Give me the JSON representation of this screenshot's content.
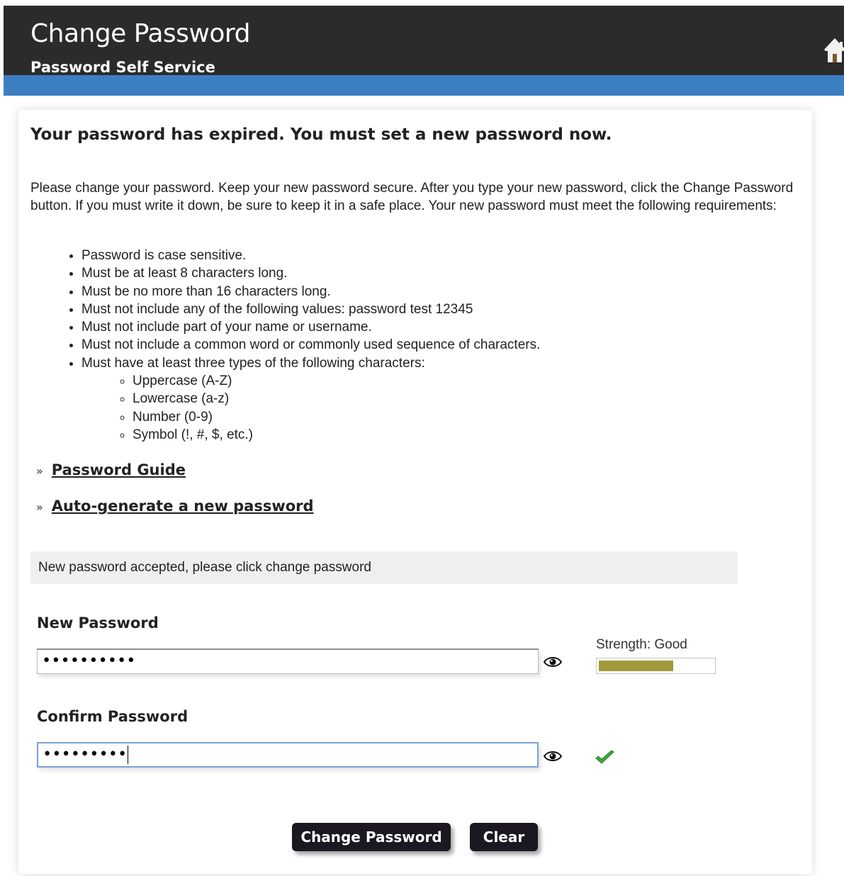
{
  "header": {
    "title": "Change Password",
    "subtitle": "Password Self Service",
    "home_icon": "home-icon"
  },
  "main": {
    "headline": "Your password has expired. You must set a new password now.",
    "intro": "Please change your password. Keep your new password secure. After you type your new password, click the Change Password button. If you must write it down, be sure to keep it in a safe place. Your new password must meet the following requirements:",
    "requirements": [
      "Password is case sensitive.",
      "Must be at least 8 characters long.",
      "Must be no more than 16 characters long.",
      "Must not include any of the following values: password test 12345",
      "Must not include part of your name or username.",
      "Must not include a common word or commonly used sequence of characters.",
      "Must have at least three types of the following characters:"
    ],
    "character_types": [
      "Uppercase (A-Z)",
      "Lowercase (a-z)",
      "Number (0-9)",
      "Symbol (!, #, $, etc.)"
    ],
    "links": {
      "bullet": "»",
      "password_guide": "Password Guide",
      "auto_generate": "Auto-generate a new password"
    },
    "status_message": "New password accepted, please click change password"
  },
  "form": {
    "new_password_label": "New Password",
    "new_password_value": "••••••••••",
    "confirm_password_label": "Confirm Password",
    "confirm_password_value": "•••••••••",
    "strength_label": "Strength: Good",
    "strength_fraction": 0.65,
    "strength_color": "#a09a3a",
    "eye_icon": "eye-icon",
    "confirm_status_icon": "checkmark-icon",
    "change_button": "Change Password",
    "clear_button": "Clear"
  },
  "colors": {
    "header_bg": "#2b2b2b",
    "accent_bar": "#3d7fc3",
    "button_bg": "#1c1822",
    "check_green": "#3fa83a"
  }
}
